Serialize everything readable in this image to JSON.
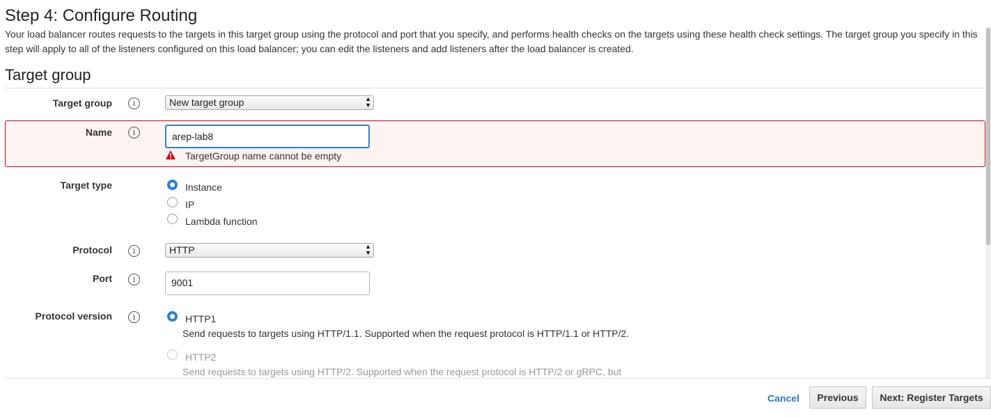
{
  "page": {
    "title": "Step 4: Configure Routing",
    "description": "Your load balancer routes requests to the targets in this target group using the protocol and port that you specify, and performs health checks on the targets using these health check settings. The target group you specify in this step will apply to all of the listeners configured on this load balancer; you can edit the listeners and add listeners after the load balancer is created."
  },
  "section": {
    "title": "Target group"
  },
  "form": {
    "target_group": {
      "label": "Target group",
      "value": "New target group"
    },
    "name": {
      "label": "Name",
      "value": "arep-lab8",
      "error": "TargetGroup name cannot be empty"
    },
    "target_type": {
      "label": "Target type",
      "options": [
        {
          "label": "Instance",
          "checked": true
        },
        {
          "label": "IP",
          "checked": false
        },
        {
          "label": "Lambda function",
          "checked": false
        }
      ]
    },
    "protocol": {
      "label": "Protocol",
      "value": "HTTP"
    },
    "port": {
      "label": "Port",
      "value": "9001"
    },
    "protocol_version": {
      "label": "Protocol version",
      "options": [
        {
          "label": "HTTP1",
          "description": "Send requests to targets using HTTP/1.1. Supported when the request protocol is HTTP/1.1 or HTTP/2.",
          "checked": true
        },
        {
          "label": "HTTP2",
          "description": "Send requests to targets using HTTP/2. Supported when the request protocol is HTTP/2 or gRPC, but",
          "checked": false
        }
      ]
    }
  },
  "footer": {
    "cancel_label": "Cancel",
    "previous_label": "Previous",
    "next_label": "Next: Register Targets"
  },
  "info_glyph": "i",
  "icons": {
    "info": "info-icon",
    "warning": "warning-icon",
    "select_arrows": "chevron-updown-icon"
  },
  "colors": {
    "error_border": "#d0021b",
    "accent": "#2f80c5",
    "link": "#2b7bbf"
  }
}
